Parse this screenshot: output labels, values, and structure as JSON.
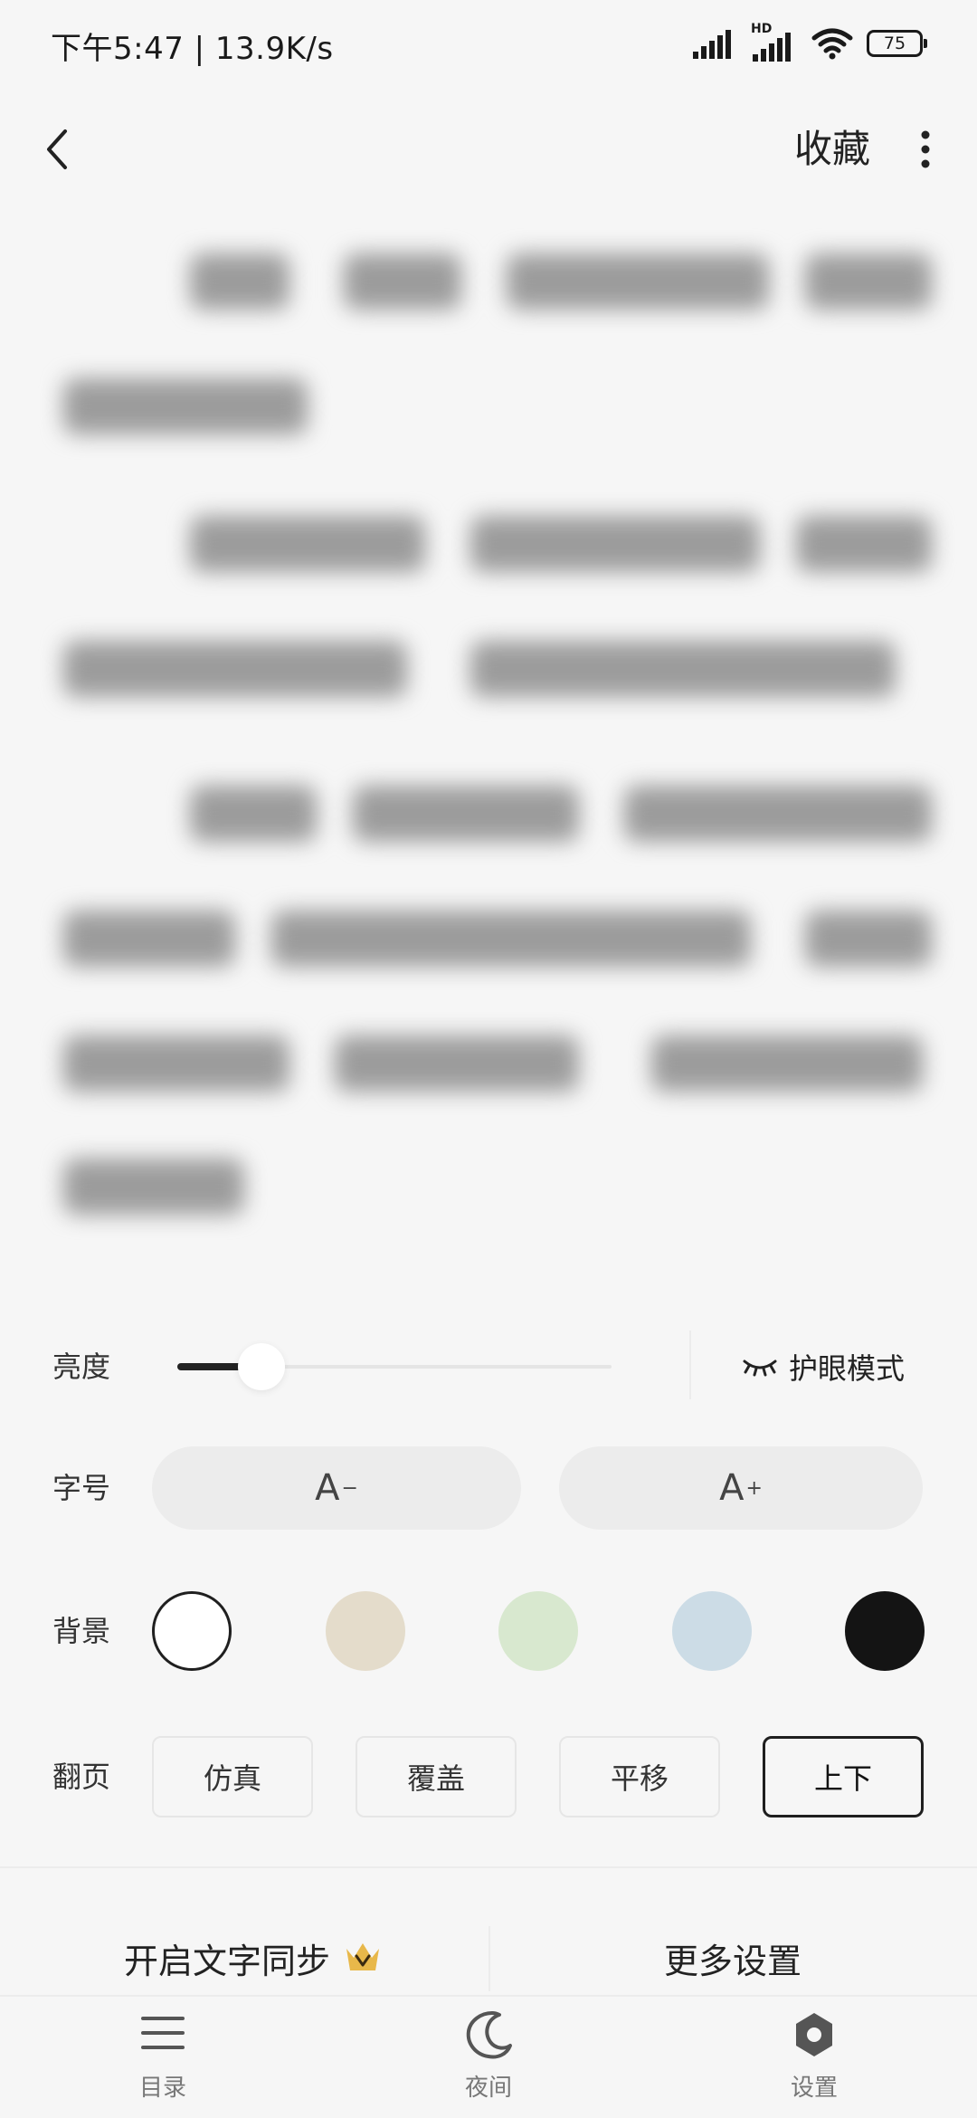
{
  "status_bar": {
    "time_speed": "下午5:47 | 13.9K/s",
    "network_label": "HD",
    "battery": "75"
  },
  "toolbar": {
    "favorite_label": "收藏"
  },
  "settings": {
    "brightness_label": "亮度",
    "brightness_level": 0.14,
    "eye_care_label": "护眼模式",
    "font_size_label": "字号",
    "font_decrease_label": "A",
    "font_decrease_sup": "−",
    "font_increase_label": "A",
    "font_increase_sup": "+",
    "background_label": "背景",
    "backgrounds": [
      {
        "color": "#ffffff",
        "selected": true
      },
      {
        "color": "#e4dccb",
        "selected": false
      },
      {
        "color": "#d8e8cf",
        "selected": false
      },
      {
        "color": "#ccdce6",
        "selected": false
      },
      {
        "color": "#141414",
        "selected": false
      }
    ],
    "page_flip_label": "翻页",
    "page_flip_options": [
      "仿真",
      "覆盖",
      "平移",
      "上下"
    ],
    "page_flip_selected": "上下",
    "sync_label": "开启文字同步",
    "more_settings_label": "更多设置"
  },
  "bottom_nav": {
    "items": [
      {
        "label": "目录",
        "icon": "menu-icon"
      },
      {
        "label": "夜间",
        "icon": "moon-icon"
      },
      {
        "label": "设置",
        "icon": "settings-icon"
      }
    ]
  },
  "colors": {
    "background": "#f6f6f6",
    "accent": "#1f1f1f",
    "vip_crown": "#e8b84a"
  }
}
